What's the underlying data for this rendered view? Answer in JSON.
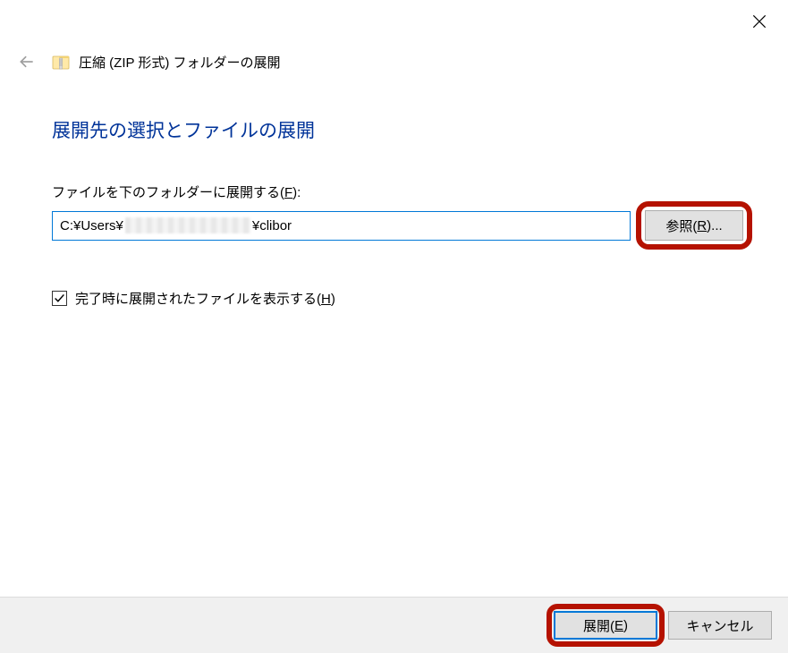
{
  "close_label": "×",
  "window_title": "圧縮 (ZIP 形式) フォルダーの展開",
  "heading": "展開先の選択とファイルの展開",
  "field_label_pre": "ファイルを下のフォルダーに展開する(",
  "field_label_key": "F",
  "field_label_post": "):",
  "path_prefix": "C:¥Users¥",
  "path_suffix": "¥clibor",
  "browse_pre": "参照(",
  "browse_key": "R",
  "browse_post": ")...",
  "checkbox_checked": true,
  "checkbox_pre": "完了時に展開されたファイルを表示する(",
  "checkbox_key": "H",
  "checkbox_post": ")",
  "extract_pre": "展開(",
  "extract_key": "E",
  "extract_post": ")",
  "cancel_label": "キャンセル"
}
